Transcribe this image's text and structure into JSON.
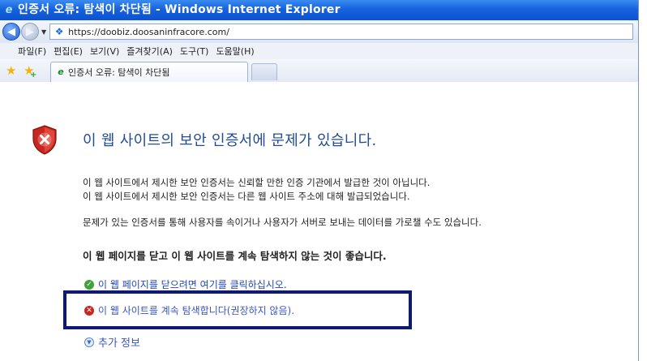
{
  "window": {
    "title": "인증서 오류: 탐색이 차단됨 - Windows Internet Explorer"
  },
  "address": {
    "url": "https://doobiz.doosaninfracore.com/"
  },
  "menu": {
    "items": [
      "파일(F)",
      "편집(E)",
      "보기(V)",
      "즐겨찾기(A)",
      "도구(T)",
      "도움말(H)"
    ]
  },
  "tabs": {
    "active_label": "인증서 오류: 탐색이 차단됨"
  },
  "page": {
    "headline": "이 웹 사이트의 보안 인증서에 문제가 있습니다.",
    "line1": "이 웹 사이트에서 제시한 보안 인증서는 신뢰할 만한 인증 기관에서 발급한 것이 아닙니다.",
    "line2": "이 웹 사이트에서 제시한 보안 인증서는 다른 웹 사이트 주소에 대해 발급되었습니다.",
    "line3": "문제가 있는 인증서를 통해 사용자를 속이거나 사용자가 서버로 보내는 데이터를 가로챌 수도 있습니다.",
    "recommendation": "이 웹 페이지를 닫고 이 웹 사이트를 계속 탐색하지 않는 것이 좋습니다.",
    "close_link": "이 웹 페이지를 닫으려면 여기를 클릭하십시오.",
    "continue_link": "이 웹 사이트를 계속 탐색합니다(권장하지 않음).",
    "more_info": "추가 정보"
  },
  "colors": {
    "title_bar": "#0b52d0",
    "headline": "#224c9a",
    "link": "#2147b8",
    "highlight_box": "#0e1a6e",
    "shield": "#c9261e"
  }
}
